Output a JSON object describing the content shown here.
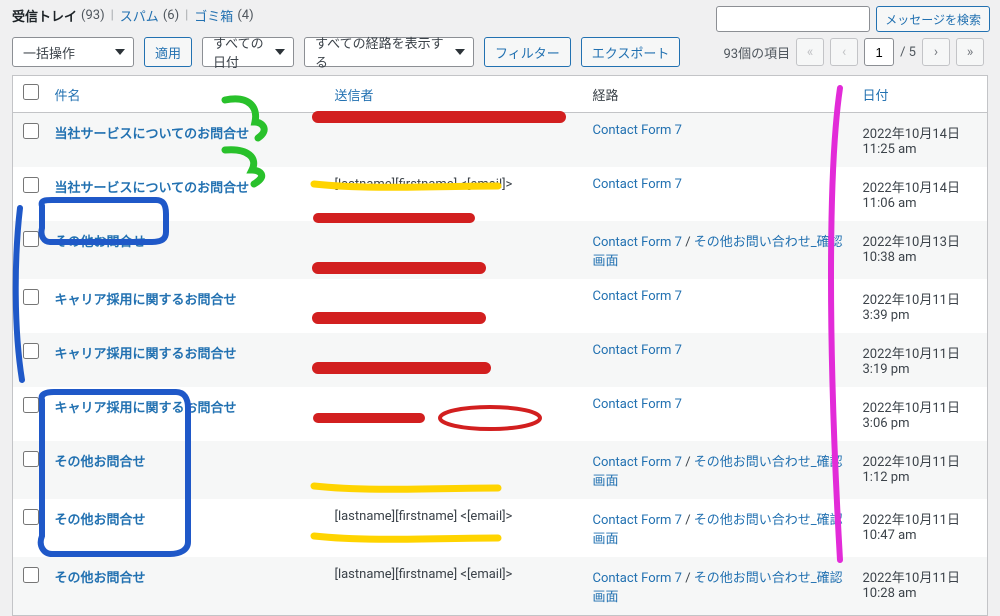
{
  "nav": {
    "inbox_label": "受信トレイ",
    "inbox_count": "(93)",
    "spam_label": "スパム",
    "spam_count": "(6)",
    "trash_label": "ゴミ箱",
    "trash_count": "(4)"
  },
  "search": {
    "placeholder": "",
    "button": "メッセージを検索"
  },
  "bulk": {
    "select_label": "一括操作",
    "apply": "適用"
  },
  "filters": {
    "date_label": "すべての日付",
    "channel_label": "すべての経路を表示する",
    "filter_btn": "フィルター",
    "export_btn": "エクスポート"
  },
  "pager": {
    "items_text": "93個の項目",
    "current": "1",
    "total_text": "/ 5"
  },
  "columns": {
    "subject": "件名",
    "from": "送信者",
    "channel": "経路",
    "date": "日付"
  },
  "channel_strings": {
    "cf7": "Contact Form 7",
    "other": "その他お問い合わせ_確認画面",
    "sep": " / "
  },
  "rows": [
    {
      "subject": "当社サービスについてのお問合せ",
      "from_type": "redacted",
      "channel": "cf7",
      "date": "2022年10月14日 11:25 am"
    },
    {
      "subject": "当社サービスについてのお問合せ",
      "from_type": "text",
      "from": "[lastname][firstname] <[email]>",
      "channel": "cf7",
      "date": "2022年10月14日 11:06 am"
    },
    {
      "subject": "その他お問合せ",
      "from_type": "redacted",
      "channel": "cf7_other",
      "date": "2022年10月13日 10:38 am"
    },
    {
      "subject": "キャリア採用に関するお問合せ",
      "from_type": "redacted",
      "channel": "cf7",
      "date": "2022年10月11日 3:39 pm"
    },
    {
      "subject": "キャリア採用に関するお問合せ",
      "from_type": "redacted",
      "channel": "cf7",
      "date": "2022年10月11日 3:19 pm"
    },
    {
      "subject": "キャリア採用に関するお問合せ",
      "from_type": "redacted",
      "channel": "cf7",
      "date": "2022年10月11日 3:06 pm"
    },
    {
      "subject": "その他お問合せ",
      "from_type": "redacted",
      "channel": "cf7_other",
      "date": "2022年10月11日 1:12 pm"
    },
    {
      "subject": "その他お問合せ",
      "from_type": "text",
      "from": "[lastname][firstname] <[email]>",
      "channel": "cf7_other",
      "date": "2022年10月11日 10:47 am"
    },
    {
      "subject": "その他お問合せ",
      "from_type": "text",
      "from": "[lastname][firstname] <[email]>",
      "channel": "cf7_other",
      "date": "2022年10月11日 10:28 am"
    }
  ]
}
